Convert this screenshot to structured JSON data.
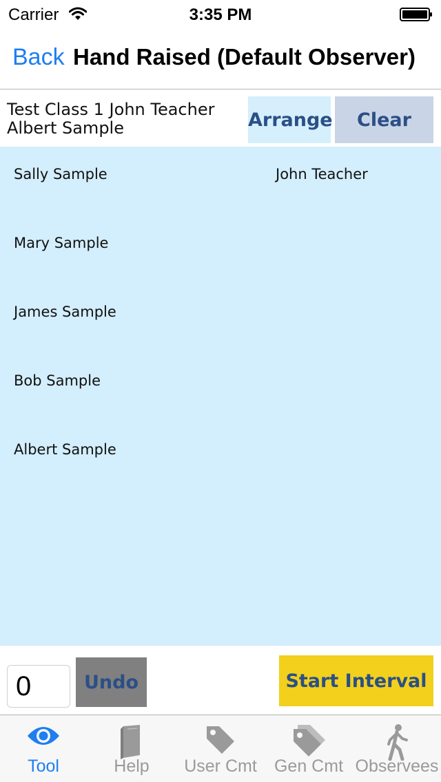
{
  "status_bar": {
    "carrier": "Carrier",
    "time": "3:35 PM"
  },
  "nav": {
    "back_label": "Back",
    "title": "Hand Raised (Default Observer)"
  },
  "header": {
    "class_title": "Test Class 1 John Teacher Albert Sample",
    "arrange_label": "Arrange",
    "clear_label": "Clear"
  },
  "students": [
    "Sally Sample",
    "Mary Sample",
    "James Sample",
    "Bob Sample",
    "Albert Sample"
  ],
  "teacher": "John Teacher",
  "controls": {
    "count_value": "0",
    "undo_label": "Undo",
    "start_interval_label": "Start Interval"
  },
  "tabs": [
    {
      "label": "Tool",
      "icon": "eye-icon",
      "active": true
    },
    {
      "label": "Help",
      "icon": "book-icon",
      "active": false
    },
    {
      "label": "User Cmt",
      "icon": "tag-icon",
      "active": false
    },
    {
      "label": "Gen Cmt",
      "icon": "tags-icon",
      "active": false
    },
    {
      "label": "Observees",
      "icon": "walking-person-icon",
      "active": false
    }
  ],
  "colors": {
    "accent_blue": "#1e7ef2",
    "observation_bg": "#d3eefc",
    "button_text": "#2b4f86",
    "start_interval_bg": "#f2d01c",
    "undo_bg": "#808080",
    "clear_bg": "#c9d4e6"
  }
}
